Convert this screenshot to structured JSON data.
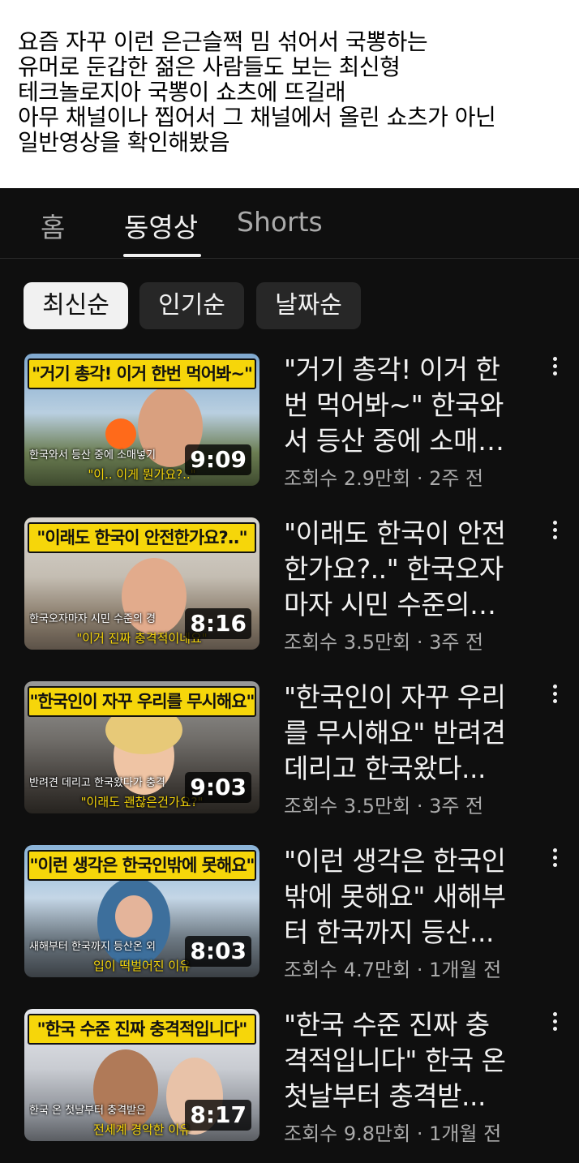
{
  "caption": {
    "lines": [
      "요즘 자꾸 이런 은근슬쩍 밈 섞어서 국뽕하는",
      "유머로 둔갑한 젊은 사람들도 보는 최신형",
      "테크놀로지아 국뽕이 쇼츠에 뜨길래",
      "아무 채널이나 찝어서 그 채널에서 올린 쇼츠가 아닌",
      "일반영상을 확인해봤음"
    ]
  },
  "tabs": [
    "홈",
    "동영상",
    "Shorts"
  ],
  "active_tab": "동영상",
  "chips": [
    "최신순",
    "인기순",
    "날짜순"
  ],
  "selected_chip": "최신순",
  "videos": [
    {
      "thumb_title": "\"거기 총각! 이거 한번 먹어봐~\"",
      "thumb_sub1": "한국와서 등산 중에 소매넣기",
      "thumb_sub2": "\"이.. 이게 뭔가요?..\"",
      "duration": "9:09",
      "title_lines": [
        "\"거기 총각! 이거 한",
        "번 먹어봐~\" 한국와",
        "서 등산 중에 소매…"
      ],
      "meta": "조회수 2.9만회 · 2주 전"
    },
    {
      "thumb_title": "\"이래도 한국이 안전한가요?..\"",
      "thumb_sub1": "한국오자마자 시민 수준의 경",
      "thumb_sub2": "\"이거 진짜 충격적이네요\"",
      "duration": "8:16",
      "title_lines": [
        "\"이래도 한국이 안전",
        "한가요?..\" 한국오자",
        "마자 시민 수준의…"
      ],
      "meta": "조회수 3.5만회 · 3주 전"
    },
    {
      "thumb_title": "\"한국인이 자꾸 우리를 무시해요\"",
      "thumb_sub1": "반려견 데리고 한국왔다가 충격",
      "thumb_sub2": "\"이래도 괜찮은건가요?\"",
      "duration": "9:03",
      "title_lines": [
        "\"한국인이 자꾸 우리",
        "를 무시해요\" 반려견",
        "데리고 한국왔다..."
      ],
      "meta": "조회수 3.5만회 · 3주 전"
    },
    {
      "thumb_title": "\"이런 생각은 한국인밖에 못해요\"",
      "thumb_sub1": "새해부터 한국까지 등산온 외",
      "thumb_sub2": "입이 떡벌어진 이유",
      "duration": "8:03",
      "title_lines": [
        "\"이런 생각은 한국인",
        "밖에 못해요\" 새해부",
        "터 한국까지 등산..."
      ],
      "meta": "조회수 4.7만회 · 1개월 전"
    },
    {
      "thumb_title": "\"한국 수준 진짜 충격적입니다\"",
      "thumb_sub1": "한국 온 첫날부터 충격받은",
      "thumb_sub2": "전세계 경악한 이유",
      "duration": "8:17",
      "title_lines": [
        "\"한국 수준 진짜 충",
        "격적입니다\" 한국 온",
        "첫날부터 충격받..."
      ],
      "meta": "조회수 9.8만회 · 1개월 전"
    }
  ],
  "icons": {
    "more": "more-vertical-icon"
  },
  "colors": {
    "background": "#0f0f0f",
    "text": "#f1f1f1",
    "secondary": "#aaaaaa",
    "chip": "#272727",
    "thumb_banner": "#f6d60a"
  }
}
